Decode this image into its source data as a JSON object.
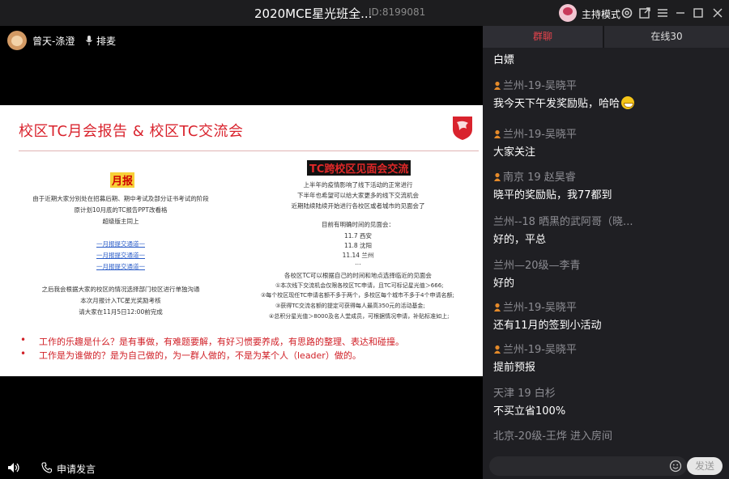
{
  "titlebar": {
    "title": "2020MCE星光班全...",
    "room_id": "ID:8199081",
    "mode_label": "主持模式"
  },
  "user_bar": {
    "name": "曾天-涤澄",
    "queue_label": "排麦"
  },
  "slide": {
    "title": "校区TC月会报告 & 校区TC交流会",
    "left_heading": "月报",
    "left_lines": [
      "由于近期大家分别处在招募后期、期中考试及部分证书考试的阶段",
      "原计划10月底的TC报告PPT改看格",
      "超级版主同上"
    ],
    "links": [
      "一月报提交通道一",
      "一月报提交通道一",
      "一月报提交通道一"
    ],
    "left_footer": [
      "之后我会根据大家的校区的情况选择部门校区进行单独沟通",
      "本次月报计入TC星光奖励考核",
      "请大家在11月5日12:00前完成"
    ],
    "right_heading": "TC跨校区见面会交流",
    "right_lines": [
      "上半年的疫情影响了线下活动的正常进行",
      "下半年也希望可以给大家更多的线下交流机会",
      "近期陆续陆续开始进行各校区或者城市的见面会了"
    ],
    "schedule_intro": "目前有明确时间的见面会：",
    "schedule": [
      "11.7 西安",
      "11.8 沈阳",
      "11.14 兰州",
      "..."
    ],
    "rules": [
      "各校区TC可以根据自己的时间和地点选择临近的见面会",
      "①本次线下交流机会仅限各校区TC申请，且TC可标记星光值＞666;",
      "②每个校区现任TC申请名额不多于两个，多校区每个城市不多于4个申请名额;",
      "③获得TC交流名额的提定可获得每人最高350元的活动基金;",
      "④总积分星光值＞8000及名人堂成员，可根据情况申请，补贴标准如上;"
    ],
    "bullets": [
      "工作的乐趣是什么？是有事做，有难题要解，有好习惯要养成，有思路的整理、表达和碰撞。",
      "工作是为谁做的？是为自己做的，为一群人做的，不是为某个人（leader）做的。"
    ]
  },
  "bottom_bar": {
    "apply_label": "申请发言"
  },
  "panel": {
    "tabs": [
      "群聊",
      "在线30"
    ],
    "messages": [
      {
        "sender": "",
        "content": "白嫖",
        "badge": false
      },
      {
        "sender": "兰州-19-吴晓平",
        "content": "我今天下午发奖励贴，哈哈",
        "badge": true,
        "emoji": true
      },
      {
        "sender": "兰州-19-吴晓平",
        "content": "大家关注",
        "badge": true
      },
      {
        "sender": "南京 19 赵昊睿",
        "content": "晓平的奖励贴，我77都到",
        "badge": true
      },
      {
        "sender": "兰州--18 晒黑的武阿哥（晓...",
        "content": "好的，平总",
        "badge": false
      },
      {
        "sender": "兰州—20级—李青",
        "content": "好的",
        "badge": false
      },
      {
        "sender": "兰州-19-吴晓平",
        "content": "还有11月的签到小活动",
        "badge": true
      },
      {
        "sender": "兰州-19-吴晓平",
        "content": "提前预报",
        "badge": true
      },
      {
        "sender": "天津 19 白杉",
        "content": "不买立省100%",
        "badge": false
      },
      {
        "sender": "北京-20级-王烨 进入房间",
        "content": "",
        "badge": false
      }
    ],
    "input_placeholder": "",
    "send_label": "发送"
  },
  "colors": {
    "accent": "#e8434c",
    "slide_red": "#d9232d",
    "link_blue": "#2a5cc8"
  }
}
